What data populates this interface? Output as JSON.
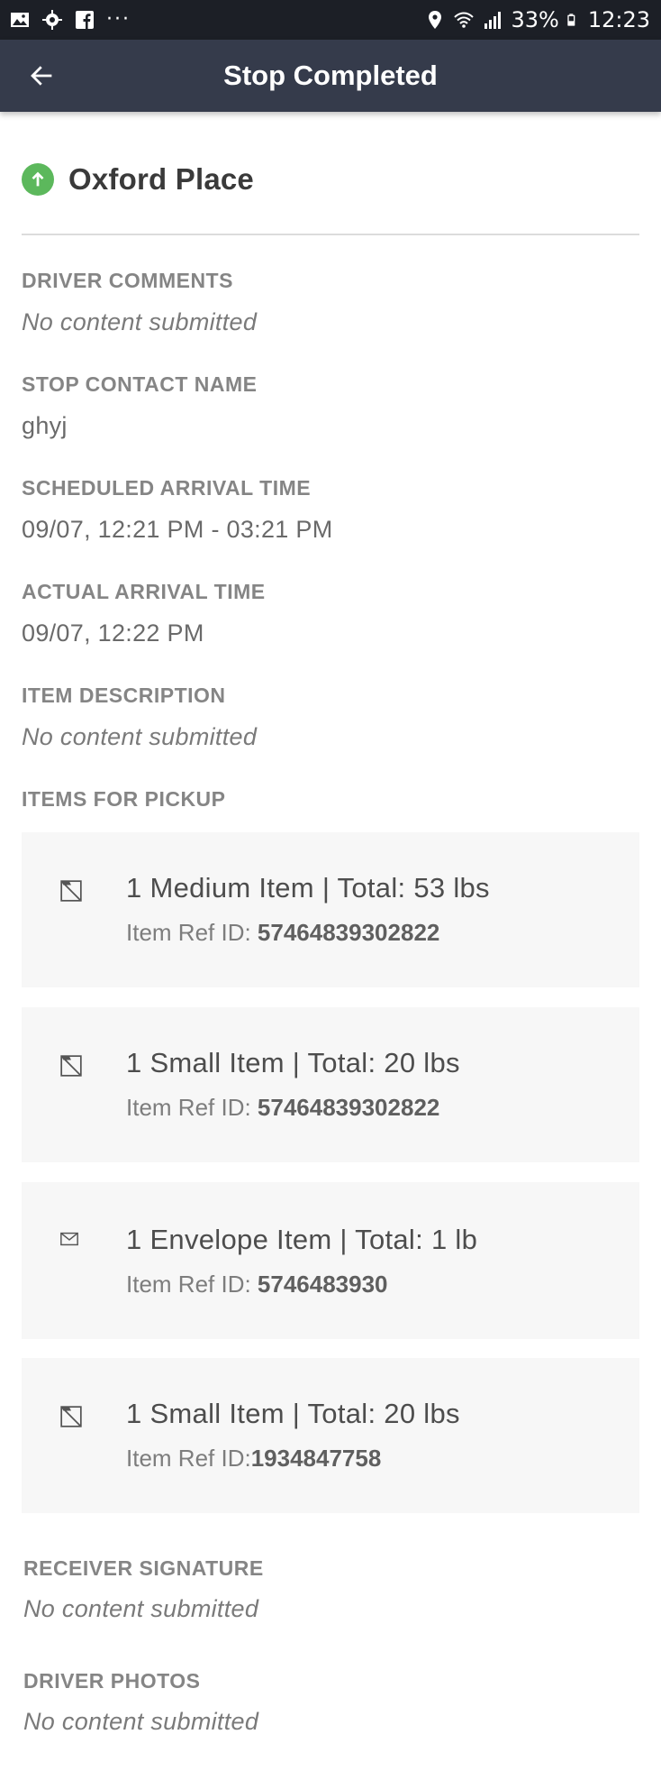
{
  "status_bar": {
    "battery": "33%",
    "time": "12:23",
    "icons": [
      "gallery-icon",
      "location-target-icon",
      "facebook-icon",
      "more-dots-icon",
      "location-pin-icon",
      "wifi-icon",
      "signal-icon",
      "battery-icon"
    ],
    "more": "···"
  },
  "app_bar": {
    "title": "Stop Completed",
    "back_icon": "arrow-left-icon",
    "background": "#353b4b"
  },
  "stop": {
    "name": "Oxford Place",
    "icon": "pickup-arrow-up-icon",
    "icon_color": "#5cb85c"
  },
  "fields": {
    "driver_comments": {
      "label": "DRIVER COMMENTS",
      "value": "No content submitted"
    },
    "stop_contact_name": {
      "label": "STOP CONTACT NAME",
      "value": "ghyj"
    },
    "scheduled_arrival_time": {
      "label": "SCHEDULED ARRIVAL TIME",
      "value": "09/07, 12:21 PM - 03:21 PM"
    },
    "actual_arrival_time": {
      "label": "ACTUAL ARRIVAL TIME",
      "value": "09/07, 12:22 PM"
    },
    "item_description": {
      "label": "ITEM DESCRIPTION",
      "value": "No content submitted"
    },
    "items_for_pickup": {
      "label": "ITEMS FOR PICKUP"
    },
    "receiver_signature": {
      "label": "RECEIVER SIGNATURE",
      "value": "No content submitted"
    },
    "driver_photos": {
      "label": "DRIVER PHOTOS",
      "value": "No content submitted"
    }
  },
  "items": [
    {
      "icon": "package-icon",
      "title": "1 Medium Item | Total: 53 lbs",
      "ref_label": "Item Ref ID: ",
      "ref_id": "57464839302822"
    },
    {
      "icon": "package-icon",
      "title": "1 Small Item | Total: 20 lbs",
      "ref_label": "Item Ref ID: ",
      "ref_id": "57464839302822"
    },
    {
      "icon": "envelope-icon",
      "title": "1 Envelope Item | Total: 1 lb",
      "ref_label": "Item Ref ID: ",
      "ref_id": "5746483930"
    },
    {
      "icon": "package-icon",
      "title": "1 Small Item | Total: 20 lbs",
      "ref_label": "Item Ref ID:",
      "ref_id": "1934847758"
    }
  ]
}
